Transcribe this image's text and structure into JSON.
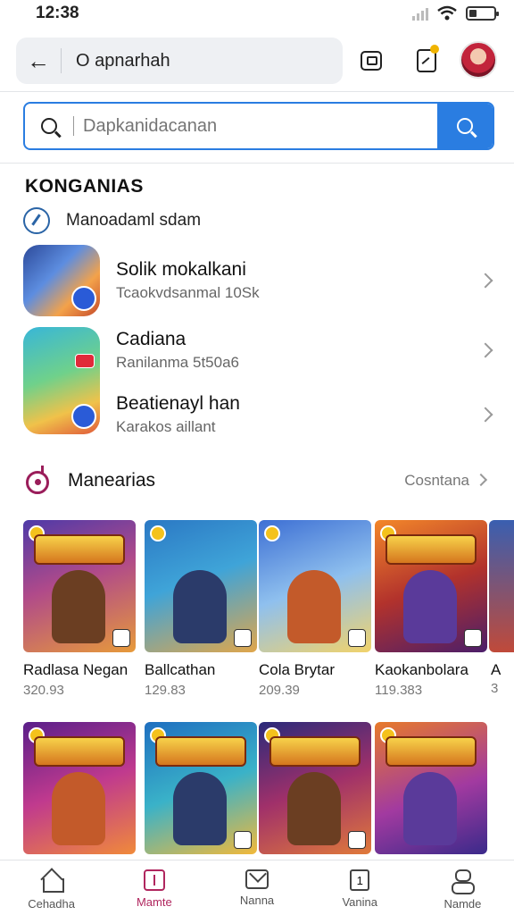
{
  "status": {
    "time": "12:38",
    "battery_level": 0.3
  },
  "topbar": {
    "query": "O apnarhah"
  },
  "search": {
    "placeholder": "Dapkanidacanan"
  },
  "section": {
    "title": "KONGANIAS",
    "check_label": "Manoadaml sdam",
    "apps": [
      {
        "title": "Solik mokalkani",
        "subtitle": "Tcaokvdsanmal 10Sk"
      },
      {
        "title": "Cadiana",
        "subtitle": "Ranilanma 5t50a6"
      },
      {
        "title": "Beatienayl han",
        "subtitle": "Karakos aillant"
      }
    ]
  },
  "games": {
    "title": "Manearias",
    "see_all": "Cosntana",
    "row1": [
      {
        "name": "Radlasa Negan",
        "size": "320.93"
      },
      {
        "name": "Ballcathan",
        "size": "129.83"
      },
      {
        "name": "Cola Brytar",
        "size": "209.39"
      },
      {
        "name": "Kaokanbolara",
        "size": "119.383"
      }
    ],
    "partial_name": "A",
    "partial_size": "3"
  },
  "nav": {
    "items": [
      {
        "label": "Cehadha"
      },
      {
        "label": "Mamte"
      },
      {
        "label": "Nanna"
      },
      {
        "label": "Vanina"
      },
      {
        "label": "Namde"
      }
    ],
    "num_icon_text": "1"
  },
  "colors": {
    "accent": "#2a7de1",
    "active_nav": "#b0265e"
  }
}
